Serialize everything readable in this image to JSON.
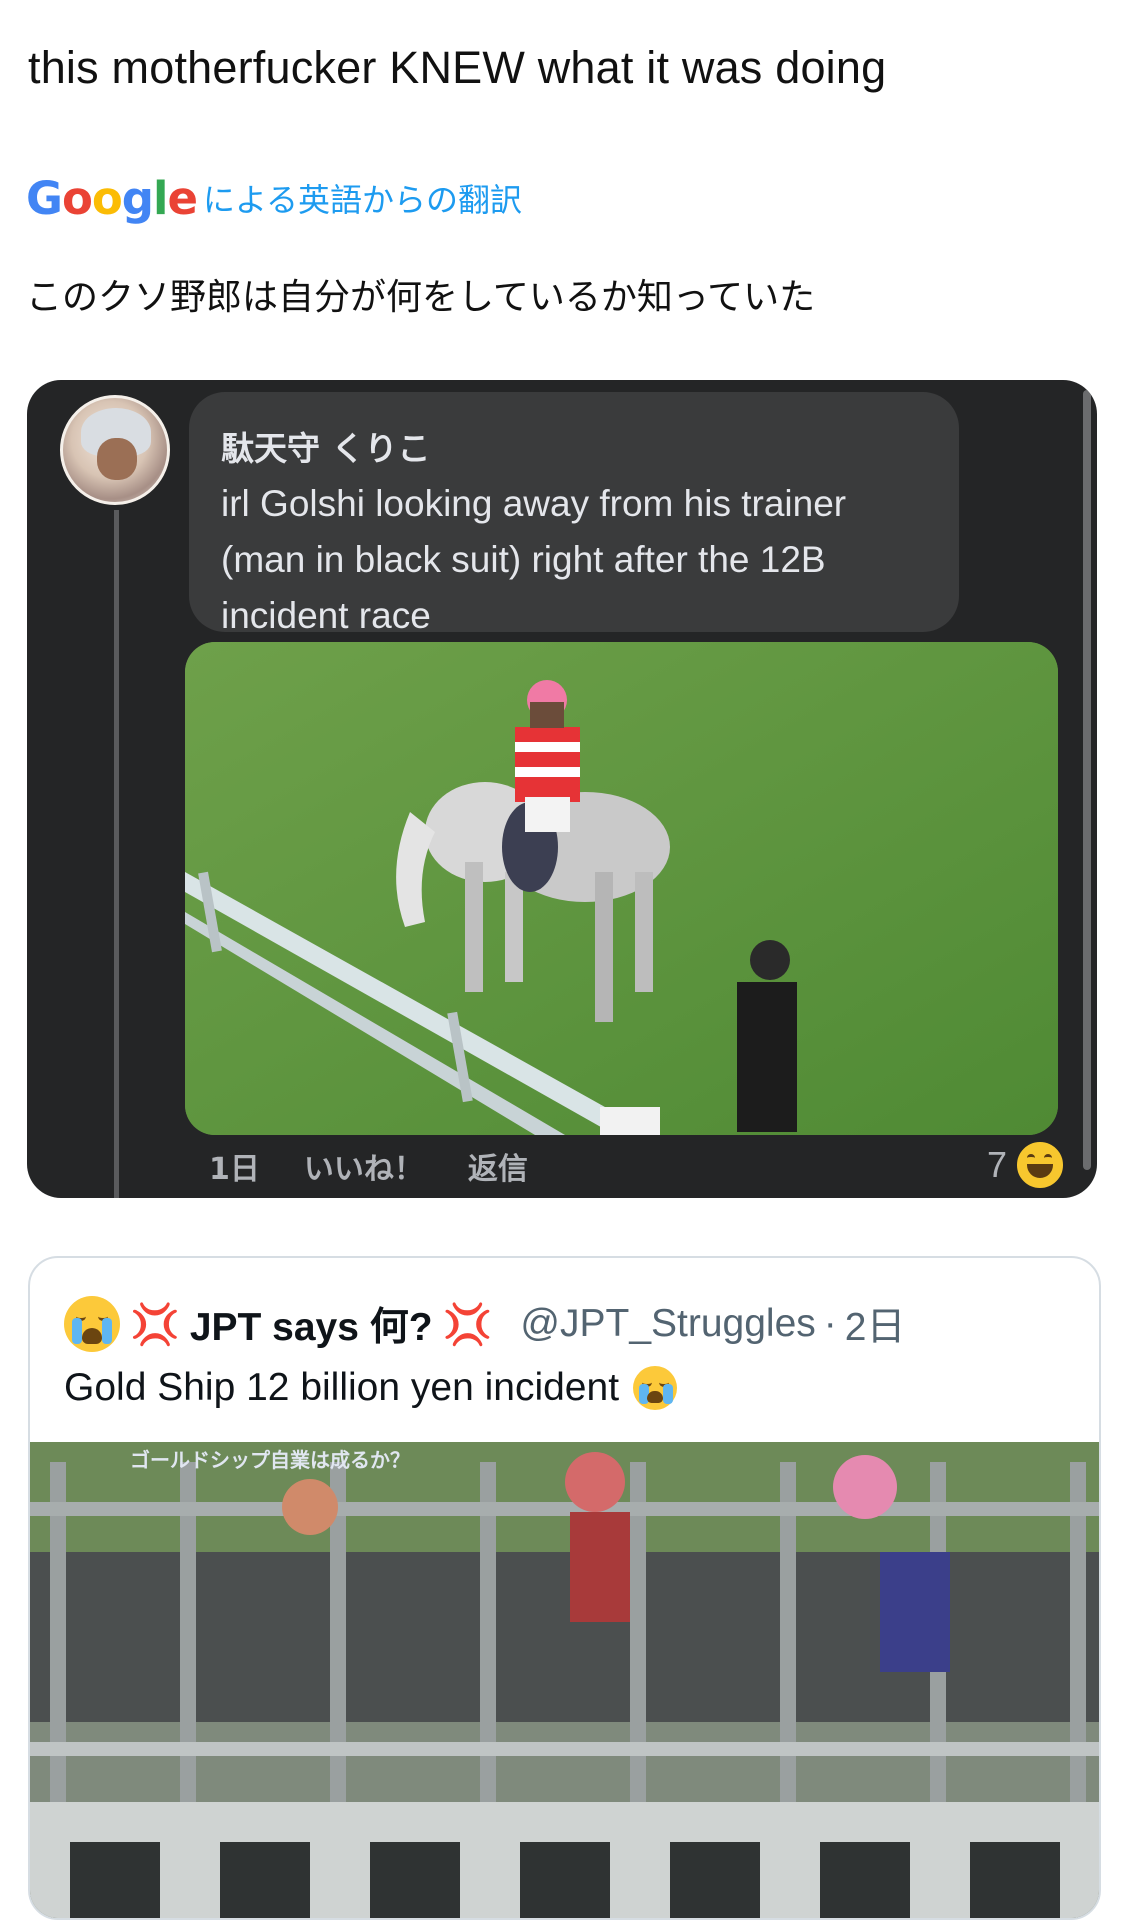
{
  "tweet": {
    "text": "this motherfucker KNEW what it was doing",
    "translate_label": "による英語からの翻訳",
    "google_logo": [
      "G",
      "o",
      "o",
      "g",
      "l",
      "e"
    ],
    "google_colors": [
      "#4285F4",
      "#EA4335",
      "#FBBC05",
      "#4285F4",
      "#34A853",
      "#EA4335"
    ],
    "translated_text": "このクソ野郎は自分が何をしているか知っていた"
  },
  "fb_post": {
    "author": "駄天守 くりこ",
    "comment_lines": [
      "irl Golshi looking away from his trainer",
      "(man in black suit) right after the 12B",
      "incident race"
    ],
    "time": "1日",
    "like_label": "いいね！",
    "reply_label": "返信",
    "reaction_count": "7",
    "reaction_icon": "haha-emoji-icon"
  },
  "quote_tweet": {
    "leading_emoji": "loudly-crying-face-icon",
    "anger_symbol": "💢",
    "name": "JPT says 何?",
    "handle": "@JPT_Struggles",
    "separator": "·",
    "age": "2日",
    "text": "Gold Ship 12 billion yen incident",
    "text_emoji": "loudly-crying-face-icon",
    "video_caption": "ゴールドシップ自業は成るか？"
  },
  "colors": {
    "fb_bg": "#242526",
    "fb_bubble": "#3a3b3c",
    "link_blue": "#1d9bf0",
    "anger_red": "#e0245e"
  }
}
